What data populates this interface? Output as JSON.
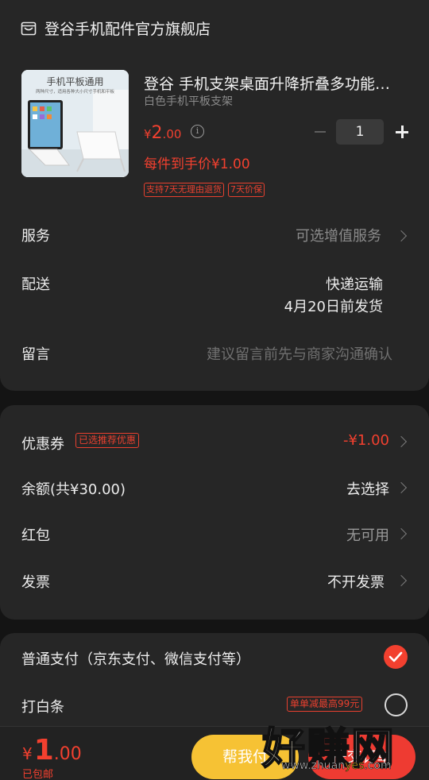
{
  "store": {
    "name": "登谷手机配件官方旗舰店",
    "icon": "store-icon"
  },
  "product": {
    "image_caption": "手机平板通用",
    "image_subcaption": "两种尺寸，适用各种大小尺寸手机和平板",
    "title": "登谷 手机支架桌面升降折叠多功能…",
    "spec": "白色手机平板支架",
    "price_symbol": "¥",
    "price_int": "2",
    "price_dec": ".00",
    "unit_price_text": "每件到手价¥1.00",
    "tags": [
      "支持7天无理由退货",
      "7天价保"
    ],
    "quantity": "1"
  },
  "rows": {
    "service_label": "服务",
    "service_value": "可选增值服务",
    "delivery_label": "配送",
    "delivery_method": "快递运输",
    "delivery_date": "4月20日前发货",
    "message_label": "留言",
    "message_placeholder": "建议留言前先与商家沟通确认"
  },
  "discounts": {
    "coupon_label": "优惠券",
    "coupon_badge": "已选推荐优惠",
    "coupon_value": "-¥1.00",
    "balance_label": "余额(共¥30.00)",
    "balance_value": "去选择",
    "redpacket_label": "红包",
    "redpacket_value": "无可用",
    "invoice_label": "发票",
    "invoice_value": "不开发票"
  },
  "payment": {
    "normal_label": "普通支付（京东支付、微信支付等）",
    "normal_selected": true,
    "baitiao_label": "打白条",
    "baitiao_promo": "单单减最高99元",
    "baitiao_selected": false
  },
  "footer": {
    "total_symbol": "¥",
    "total_int": "1",
    "total_dec": ".00",
    "free_shipping": "已包邮",
    "help_pay_label": "帮我付",
    "submit_label": "提交订单"
  },
  "watermark": {
    "text": "好赚网",
    "url_prefix": "www.zhuan",
    "url_highlight": "yes",
    "url_suffix": ".com"
  },
  "colors": {
    "accent_red": "#f2402f",
    "help_pay_yellow": "#f6c234",
    "card_bg": "#262626",
    "page_bg": "#141414"
  }
}
